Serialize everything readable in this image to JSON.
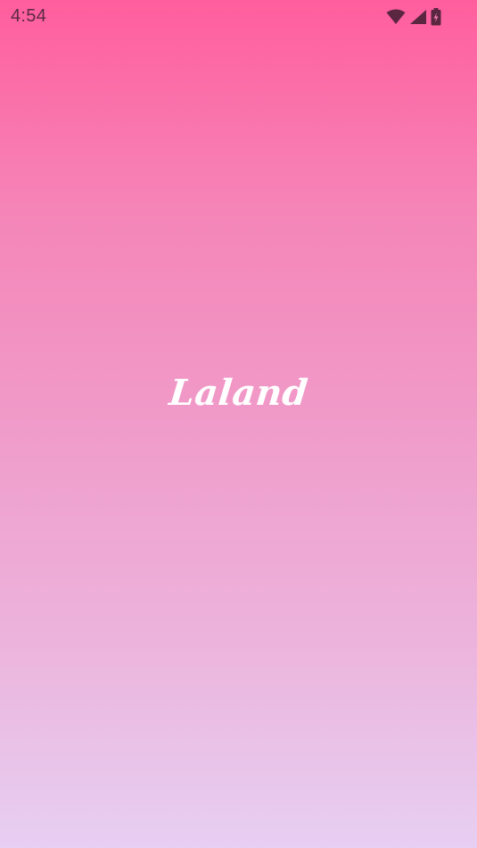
{
  "status_bar": {
    "time": "4:54",
    "icons": [
      "wifi-icon",
      "cellular-signal-icon",
      "battery-charging-icon"
    ]
  },
  "splash": {
    "logo_text": "Laland"
  },
  "colors": {
    "gradient_top": "#ff5e9d",
    "gradient_bottom": "#e7cff2",
    "logo": "#ffffff",
    "status_icons": "#5a2640"
  }
}
